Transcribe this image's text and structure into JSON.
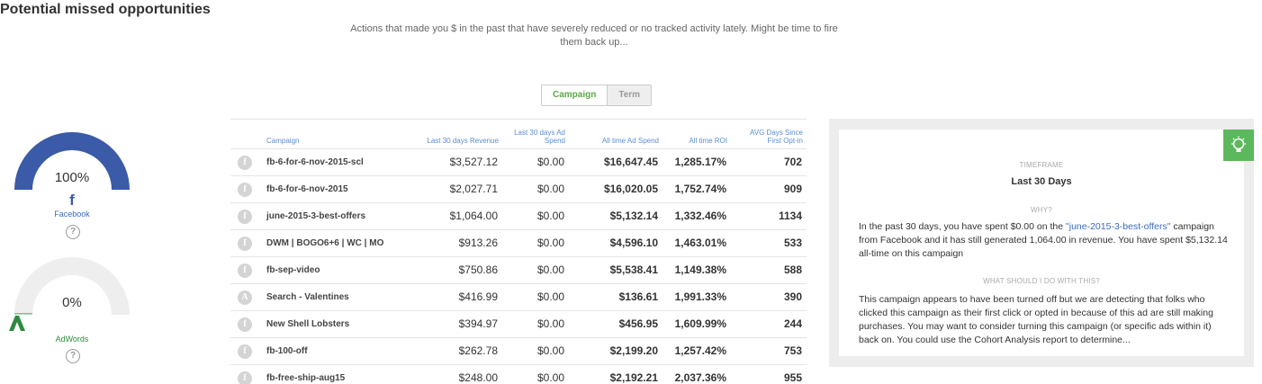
{
  "header": {
    "title": "Potential missed opportunities",
    "subtitle": "Actions that made you $ in the past that have severely reduced or no tracked activity lately. Might be time to fire them back up..."
  },
  "toggle": {
    "campaign": "Campaign",
    "term": "Term",
    "selected": "Campaign"
  },
  "gauges": [
    {
      "percent": "100%",
      "value": 1.0,
      "label": "Facebook",
      "icon": "facebook-icon",
      "color": "#3b5aa7"
    },
    {
      "percent": "0%",
      "value": 0.0,
      "label": "AdWords",
      "icon": "adwords-icon",
      "color": "#2e8b3e"
    }
  ],
  "table": {
    "headers": {
      "campaign": "Campaign",
      "revenue": "Last 30 days Revenue",
      "ad_spend": "Last 30 days Ad Spend",
      "all_time_spend": "All time Ad Spend",
      "roi": "All time ROI",
      "avg_days": "AVG Days Since First Opt-in"
    },
    "rows": [
      {
        "icon": "f",
        "campaign": "fb-6-for-6-nov-2015-scl",
        "revenue": "$3,527.12",
        "ad_spend": "$0.00",
        "all_time_spend": "$16,647.45",
        "roi": "1,285.17%",
        "avg_days": "702"
      },
      {
        "icon": "f",
        "campaign": "fb-6-for-6-nov-2015",
        "revenue": "$2,027.71",
        "ad_spend": "$0.00",
        "all_time_spend": "$16,020.05",
        "roi": "1,752.74%",
        "avg_days": "909"
      },
      {
        "icon": "f",
        "campaign": "june-2015-3-best-offers",
        "revenue": "$1,064.00",
        "ad_spend": "$0.00",
        "all_time_spend": "$5,132.14",
        "roi": "1,332.46%",
        "avg_days": "1134"
      },
      {
        "icon": "f",
        "campaign": "DWM | BOGO6+6 | WC | MO",
        "revenue": "$913.26",
        "ad_spend": "$0.00",
        "all_time_spend": "$4,596.10",
        "roi": "1,463.01%",
        "avg_days": "533"
      },
      {
        "icon": "f",
        "campaign": "fb-sep-video",
        "revenue": "$750.86",
        "ad_spend": "$0.00",
        "all_time_spend": "$5,538.41",
        "roi": "1,149.38%",
        "avg_days": "588"
      },
      {
        "icon": "A",
        "campaign": "Search - Valentines",
        "revenue": "$416.99",
        "ad_spend": "$0.00",
        "all_time_spend": "$136.61",
        "roi": "1,991.33%",
        "avg_days": "390"
      },
      {
        "icon": "f",
        "campaign": "New Shell Lobsters",
        "revenue": "$394.97",
        "ad_spend": "$0.00",
        "all_time_spend": "$456.95",
        "roi": "1,609.99%",
        "avg_days": "244"
      },
      {
        "icon": "f",
        "campaign": "fb-100-off",
        "revenue": "$262.78",
        "ad_spend": "$0.00",
        "all_time_spend": "$2,199.20",
        "roi": "1,257.42%",
        "avg_days": "753"
      },
      {
        "icon": "f",
        "campaign": "fb-free-ship-aug15",
        "revenue": "$248.00",
        "ad_spend": "$0.00",
        "all_time_spend": "$2,192.21",
        "roi": "2,037.36%",
        "avg_days": "955"
      }
    ]
  },
  "insight": {
    "timeframe_label": "TIMEFRAME",
    "timeframe_value": "Last 30 Days",
    "why_label": "WHY?",
    "why_pre": "In the past 30 days, you have spent $0.00 on the ",
    "why_link": "\"june-2015-3-best-offers\"",
    "why_post": " campaign from Facebook and it has still generated 1,064.00 in revenue. You have spent $5,132.14 all-time on this campaign",
    "what_label": "WHAT SHOULD I DO WITH THIS?",
    "what_text": "This campaign appears to have been turned off but we are detecting that folks who clicked this campaign as their first click or opted in because of this ad are still making purchases. You may want to consider turning this campaign (or specific ads within it) back on. You could use the Cohort Analysis report to determine..."
  }
}
